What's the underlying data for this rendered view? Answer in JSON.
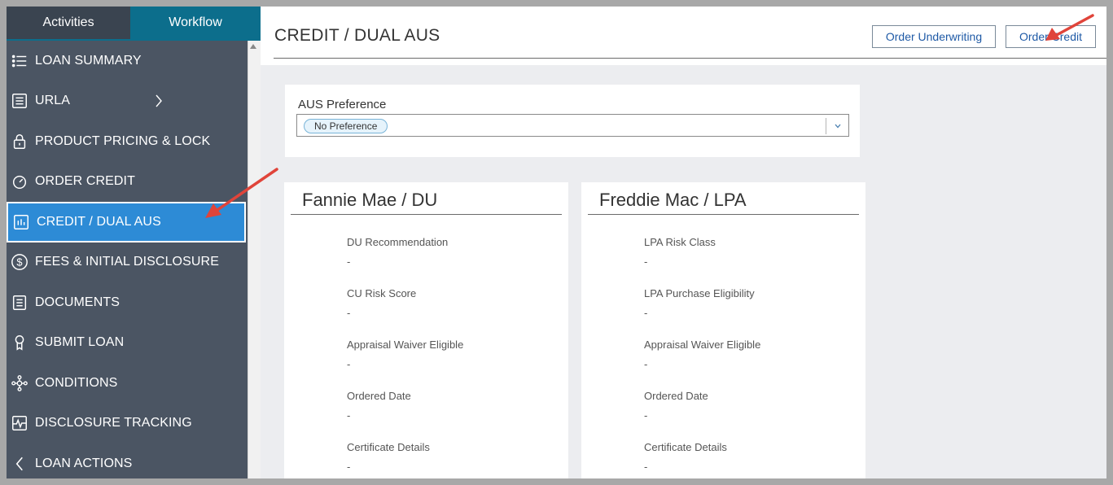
{
  "tabs": {
    "activities": "Activities",
    "workflow": "Workflow"
  },
  "sidebar": {
    "items": [
      {
        "label": "LOAN SUMMARY",
        "icon": "list-icon"
      },
      {
        "label": "URLA",
        "icon": "form-icon"
      },
      {
        "label": "PRODUCT PRICING & LOCK",
        "icon": "lock-icon"
      },
      {
        "label": "ORDER CREDIT",
        "icon": "gauge-icon"
      },
      {
        "label": "CREDIT / DUAL AUS",
        "icon": "bar-chart-icon"
      },
      {
        "label": "FEES & INITIAL DISCLOSURE",
        "icon": "dollar-icon"
      },
      {
        "label": "DOCUMENTS",
        "icon": "document-icon"
      },
      {
        "label": "SUBMIT LOAN",
        "icon": "award-icon"
      },
      {
        "label": "CONDITIONS",
        "icon": "network-icon"
      },
      {
        "label": "DISCLOSURE TRACKING",
        "icon": "pulse-icon"
      },
      {
        "label": "LOAN ACTIONS",
        "icon": "chevron-left-icon"
      }
    ],
    "active_index": 4
  },
  "header": {
    "title": "CREDIT / DUAL AUS",
    "order_underwriting": "Order Underwriting",
    "order_credit": "Order Credit"
  },
  "aus": {
    "label": "AUS Preference",
    "selected": "No Preference"
  },
  "fannie": {
    "title": "Fannie Mae / DU",
    "fields": [
      {
        "label": "DU Recommendation",
        "value": "-"
      },
      {
        "label": "CU Risk Score",
        "value": "-"
      },
      {
        "label": "Appraisal Waiver Eligible",
        "value": "-"
      },
      {
        "label": "Ordered Date",
        "value": "-"
      },
      {
        "label": "Certificate Details",
        "value": "-"
      }
    ]
  },
  "freddie": {
    "title": "Freddie Mac / LPA",
    "fields": [
      {
        "label": "LPA Risk Class",
        "value": "-"
      },
      {
        "label": "LPA Purchase Eligibility",
        "value": "-"
      },
      {
        "label": "Appraisal Waiver Eligible",
        "value": "-"
      },
      {
        "label": "Ordered Date",
        "value": "-"
      },
      {
        "label": "Certificate Details",
        "value": "-"
      }
    ]
  },
  "colors": {
    "sidebar_bg": "#4b5563",
    "workflow_tab": "#0c6e8c",
    "active_item": "#2d8bd6",
    "button_text": "#1f5aa6",
    "annotation_arrow": "#e0443a"
  }
}
